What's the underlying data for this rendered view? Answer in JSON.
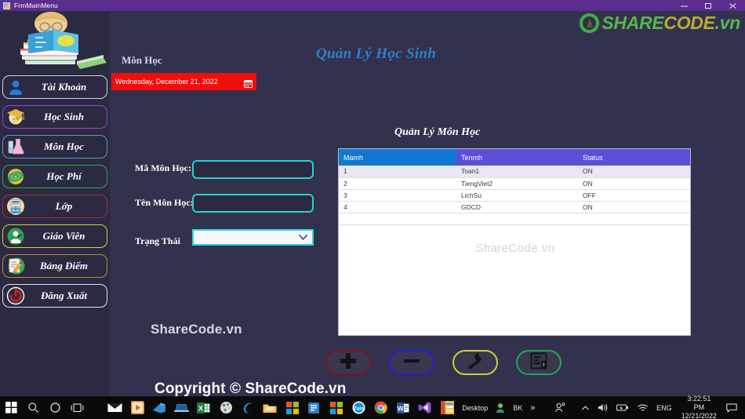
{
  "window": {
    "title": "FrmMainMenu",
    "icon": "app-icon",
    "controls": {
      "minimize": "minimize-icon",
      "maximize": "maximize-icon",
      "close": "close-icon"
    }
  },
  "brand": {
    "logo_part1": "SHARE",
    "logo_part2": "CODE",
    "logo_part3": ".vn",
    "accent_green": "#56b84a",
    "accent_olive": "#b9ad36"
  },
  "sidebar": {
    "avatar_alt": "student-reading-books",
    "items": [
      {
        "label": "Tài Khoản",
        "icon": "user-icon",
        "border": "#cfd6e0",
        "icon_bg": "#2b2a42"
      },
      {
        "label": "Học Sinh",
        "icon": "graduation-cap-icon",
        "border": "#a23fd4",
        "icon_bg": "#f2d58a"
      },
      {
        "label": "Môn Học",
        "icon": "flask-icon",
        "border": "#6d93b8",
        "icon_bg": "#dfe6ef"
      },
      {
        "label": "Học Phí",
        "icon": "money-icon",
        "border": "#2faa4e",
        "icon_bg": "#e0c96a"
      },
      {
        "label": "Lớp",
        "icon": "classroom-icon",
        "border": "#a8303c",
        "icon_bg": "#f4d2ab"
      },
      {
        "label": "Giáo Viên",
        "icon": "teacher-icon",
        "border": "#d2d23c",
        "icon_bg": "#2fa05a"
      },
      {
        "label": "Bảng Điểm",
        "icon": "scorecard-icon",
        "border": "#c08a3a",
        "icon_bg": "#3aa85e"
      },
      {
        "label": "Đăng Xuất",
        "icon": "power-icon",
        "border": "#dfe2ea",
        "icon_bg": "#2b2a42"
      }
    ]
  },
  "header": {
    "section_label": "Môn Học",
    "app_title": "Quản Lý Học Sinh",
    "title_color": "#2f7fc9"
  },
  "datepicker": {
    "value": "Wednesday, December 21, 2022",
    "icon": "calendar-icon",
    "background": "#f20d0d"
  },
  "form": {
    "fields": [
      {
        "label": "Mã Môn Học:",
        "value": "",
        "placeholder": "",
        "name": "ma-mon-hoc-input"
      },
      {
        "label": "Tên Môn Học:",
        "value": "",
        "placeholder": "",
        "name": "ten-mon-hoc-input"
      }
    ],
    "combo": {
      "label": "Trạng Thái",
      "value": "",
      "chevron": "chevron-down-icon"
    },
    "border_color": "#25d2d2"
  },
  "grid": {
    "title": "Quản Lý Môn Học",
    "watermark": "ShareCode.vn",
    "columns": [
      "Mamh",
      "Tenmh",
      "Status"
    ],
    "header_colors": [
      "#1277d1",
      "#5b4fd8",
      "#5b4fd8"
    ],
    "rows": [
      {
        "Mamh": "1",
        "Tenmh": "Toan1",
        "Status": "ON",
        "selected": true
      },
      {
        "Mamh": "2",
        "Tenmh": "TiengViet2",
        "Status": "ON",
        "selected": false
      },
      {
        "Mamh": "3",
        "Tenmh": "LichSu",
        "Status": "OFF",
        "selected": false
      },
      {
        "Mamh": "4",
        "Tenmh": "GDCD",
        "Status": "ON",
        "selected": false
      }
    ]
  },
  "actions": [
    {
      "name": "add-button",
      "icon": "plus-icon",
      "border": "#7a1421"
    },
    {
      "name": "delete-button",
      "icon": "minus-icon",
      "border": "#2020d0"
    },
    {
      "name": "edit-button",
      "icon": "tools-icon",
      "border": "#cfcf3a"
    },
    {
      "name": "save-button",
      "icon": "save-icon",
      "border": "#23a455"
    }
  ],
  "watermarks": {
    "left": "ShareCode.vn",
    "bottom": "Copyright © ShareCode.vn"
  },
  "taskbar": {
    "start": "windows-start-icon",
    "search": "search-icon",
    "cortana": "cortana-icon",
    "taskview": "task-view-icon",
    "apps": [
      "mail-icon",
      "media-player-icon",
      "office-icon",
      "laptop-icon",
      "excel-icon",
      "paint-icon",
      "edge-legacy-icon",
      "folder-icon",
      "store-icon",
      "app-icon-blue",
      "store-tiles-icon",
      "zalo-icon",
      "chrome-icon",
      "word-icon",
      "visual-studio-icon",
      "sticky-note-icon"
    ],
    "tray": {
      "desktop_label": "Desktop",
      "user_label": "BK",
      "overflow": "»",
      "people_icon": "people-icon",
      "chevron_icon": "chevron-up-icon",
      "volume_icon": "volume-icon",
      "battery_icon": "battery-icon",
      "network_icon": "wifi-icon",
      "language": "ENG",
      "time": "3:22:51 PM",
      "date": "12/21/2022",
      "notifications": "notification-icon"
    }
  }
}
